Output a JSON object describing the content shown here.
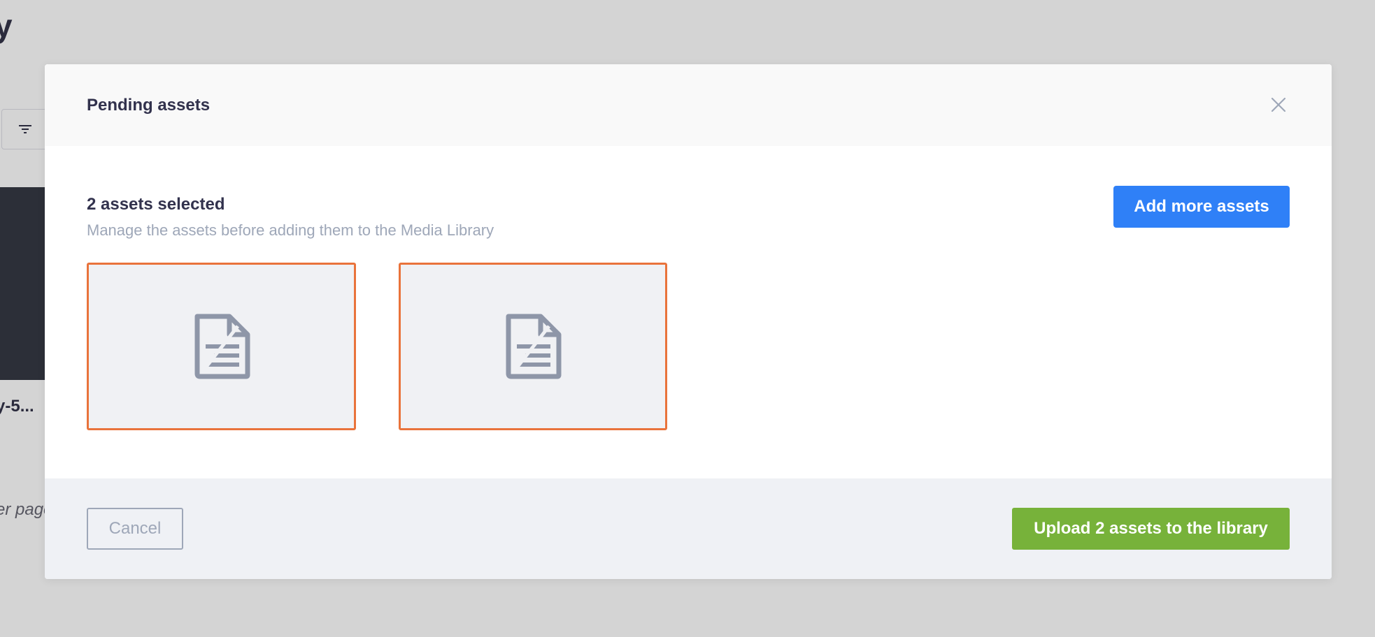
{
  "background": {
    "title_fragment": "y",
    "filter_icon": "filter-icon",
    "card_name_fragment": "y-5...",
    "per_page_fragment": "er page"
  },
  "modal": {
    "title": "Pending assets",
    "close_icon": "close-icon",
    "selected_title": "2 assets selected",
    "selected_subtitle": "Manage the assets before adding them to the Media Library",
    "add_more_label": "Add more assets",
    "assets": [
      {
        "icon": "document-icon"
      },
      {
        "icon": "document-icon"
      }
    ],
    "cancel_label": "Cancel",
    "upload_label": "Upload 2 assets to the library"
  },
  "colors": {
    "primary": "#2f80f7",
    "success": "#77b23a",
    "selected_border": "#e9733b",
    "muted_text": "#9ea7b8"
  }
}
